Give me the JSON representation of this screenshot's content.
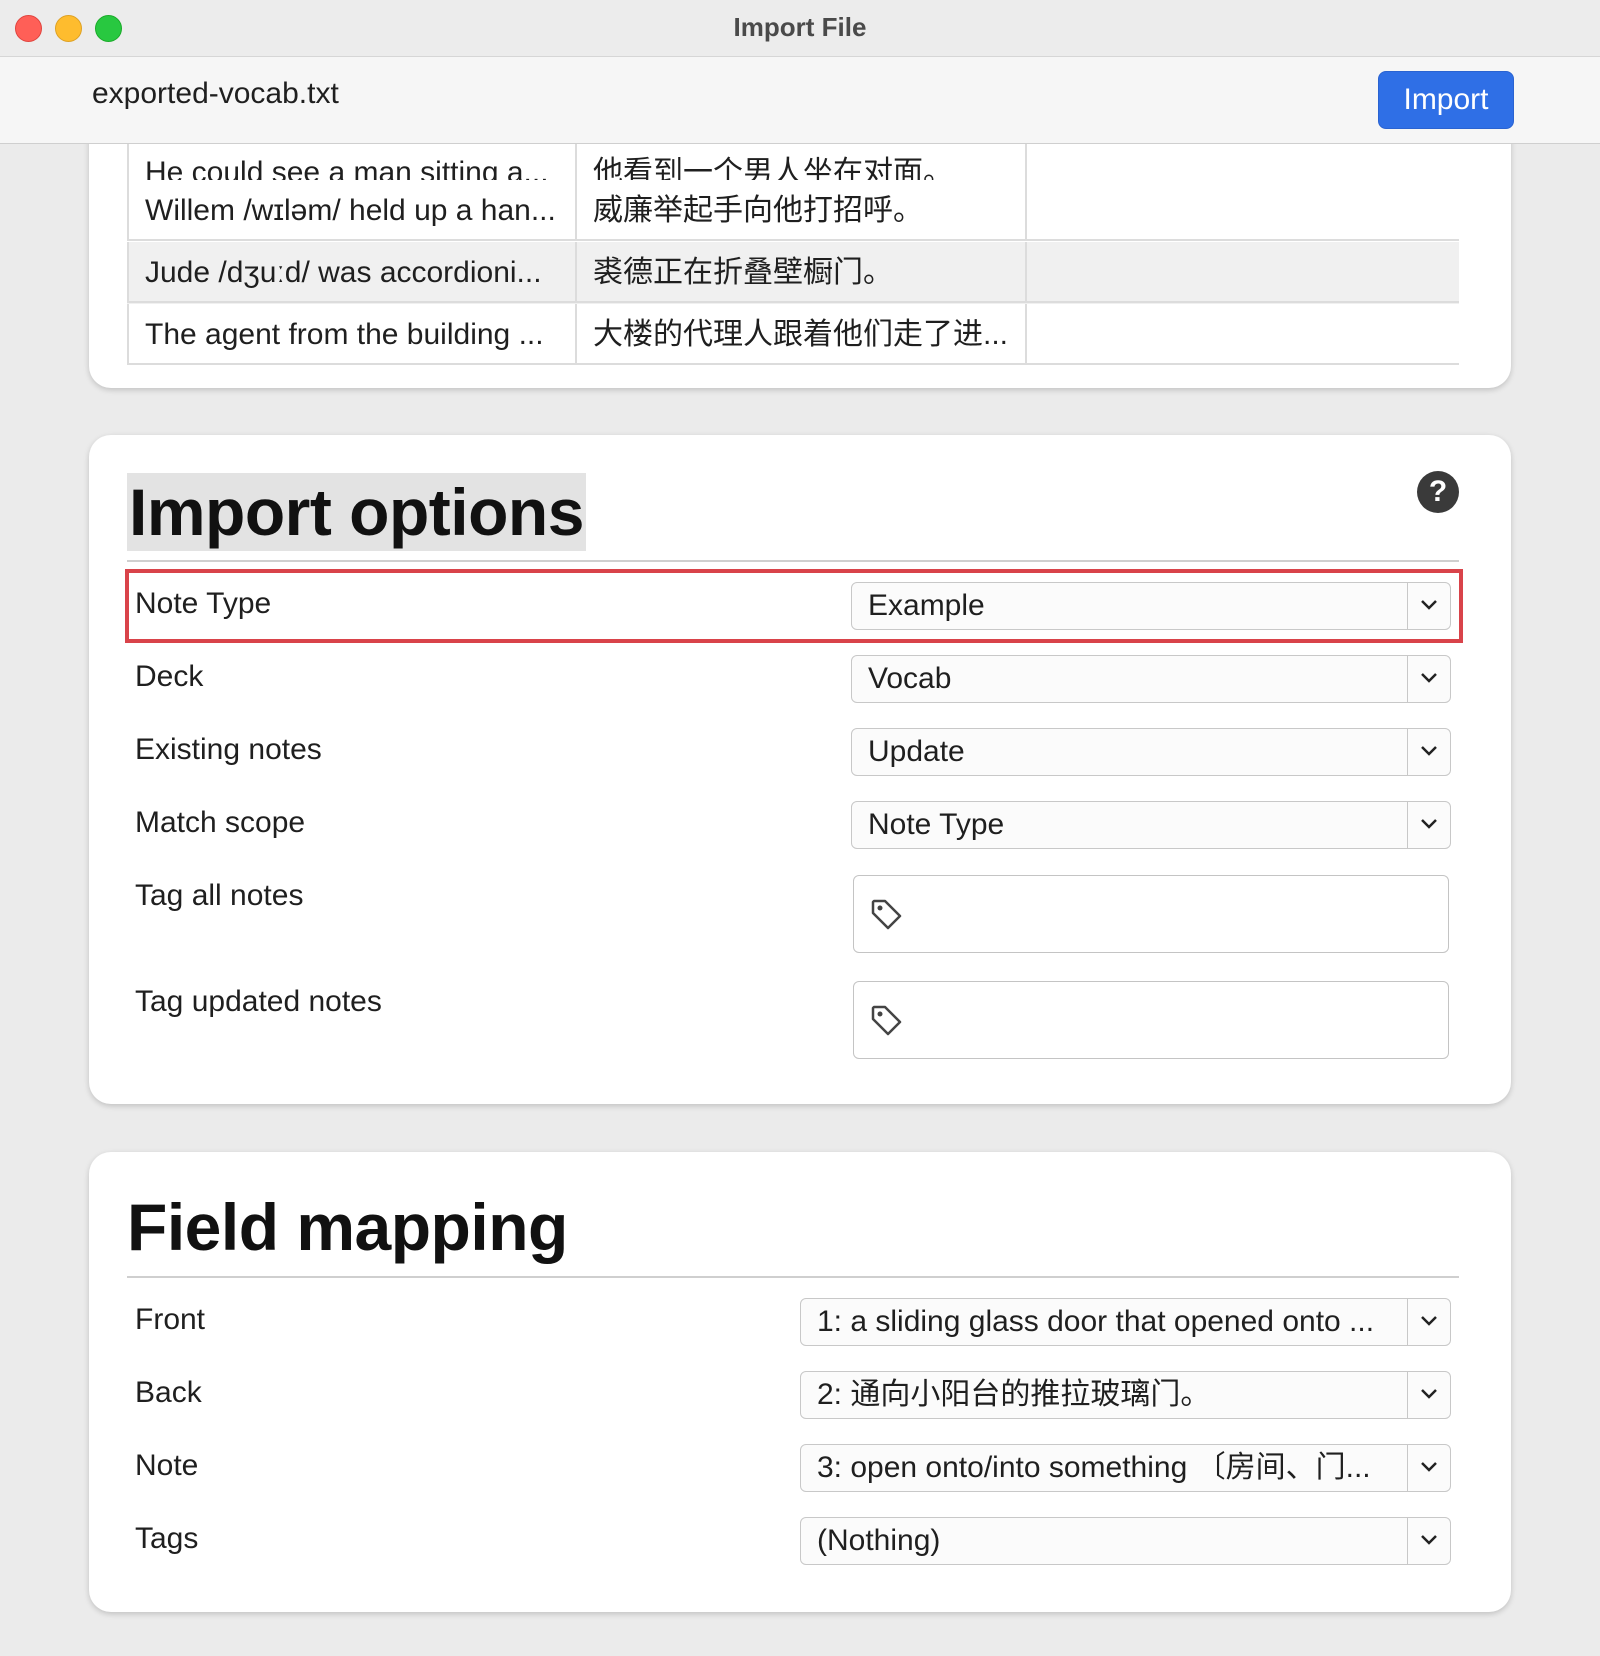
{
  "window": {
    "title": "Import File"
  },
  "header": {
    "filename": "exported-vocab.txt",
    "import_label": "Import"
  },
  "preview": {
    "rows": [
      [
        "He could see a man sitting a...",
        "他看到一个男人坐在对面。",
        ""
      ],
      [
        "Willem /wɪləm/ held up a han...",
        "威廉举起手向他打招呼。",
        ""
      ],
      [
        "Jude /dʒuːd/ was accordioni...",
        "裘德正在折叠壁橱门。",
        ""
      ],
      [
        "The agent from the building ...",
        "大楼的代理人跟着他们走了进...",
        ""
      ]
    ]
  },
  "options": {
    "title": "Import options",
    "help_icon": "question-mark-icon",
    "note_type": {
      "label": "Note Type",
      "value": "Example"
    },
    "deck": {
      "label": "Deck",
      "value": "Vocab"
    },
    "existing": {
      "label": "Existing notes",
      "value": "Update"
    },
    "scope": {
      "label": "Match scope",
      "value": "Note Type"
    },
    "tag_all": {
      "label": "Tag all notes",
      "icon": "tag-icon"
    },
    "tag_updated": {
      "label": "Tag updated notes",
      "icon": "tag-icon"
    },
    "highlight_color": "#d9434a"
  },
  "mapping": {
    "title": "Field mapping",
    "front": {
      "label": "Front",
      "value": "1: a sliding glass door that opened onto ..."
    },
    "back": {
      "label": "Back",
      "value": "2: 通向小阳台的推拉玻璃门。"
    },
    "note": {
      "label": "Note",
      "value": "3: open onto/into something 〔房间、门..."
    },
    "tags": {
      "label": "Tags",
      "value": "(Nothing)"
    }
  },
  "colors": {
    "accent": "#2f6fe6"
  }
}
